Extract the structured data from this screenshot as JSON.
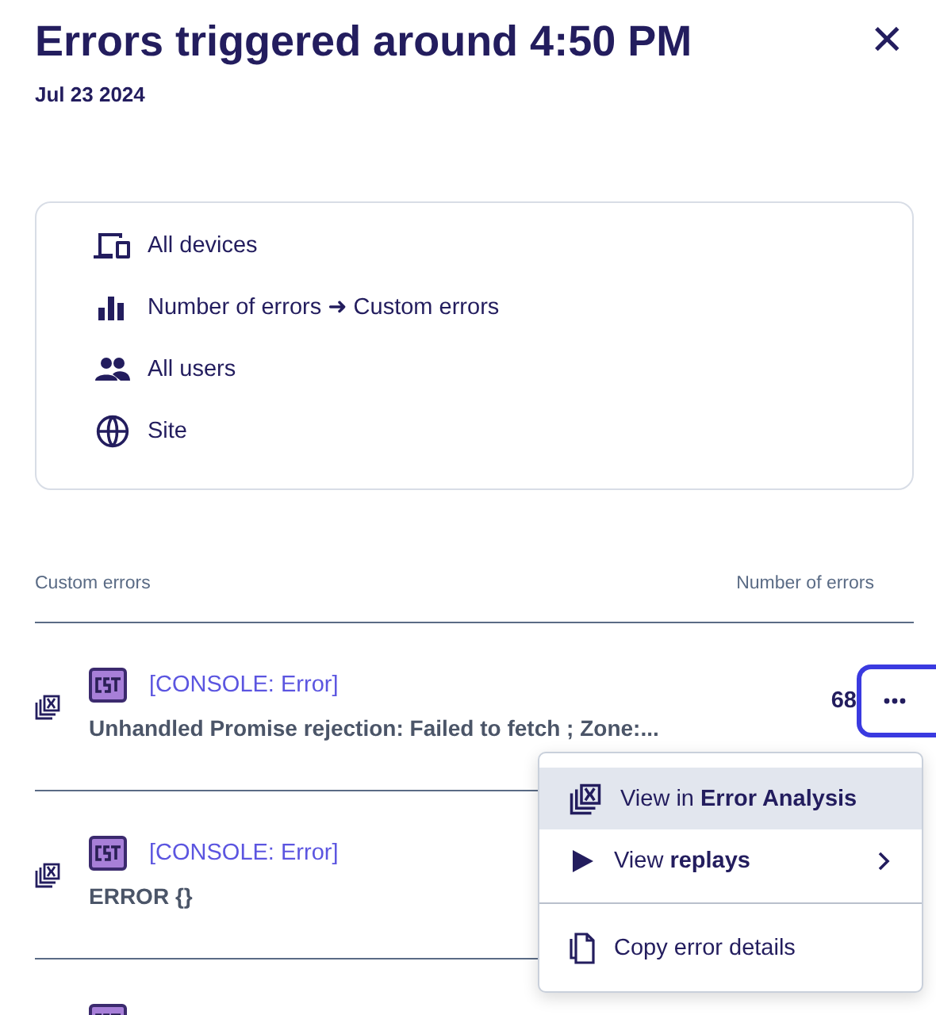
{
  "header": {
    "title": "Errors triggered around 4:50 PM",
    "date": "Jul 23 2024",
    "close_label": "✕"
  },
  "filters": [
    {
      "kind": "devices",
      "label": "All devices"
    },
    {
      "kind": "metric",
      "label": "Number of errors ➜ Custom errors"
    },
    {
      "kind": "users",
      "label": "All users"
    },
    {
      "kind": "site",
      "label": "Site"
    }
  ],
  "table": {
    "columns": [
      "Custom errors",
      "Number of errors"
    ],
    "rows": [
      {
        "type": "[CONSOLE: Error]",
        "message": "Unhandled Promise rejection: Failed to fetch ; Zone:...",
        "count": "68",
        "menu_open": true
      },
      {
        "type": "[CONSOLE: Error]",
        "message": "ERROR {}",
        "count": "",
        "menu_open": false
      },
      {
        "menu_open": false
      }
    ]
  },
  "menu": {
    "items": [
      {
        "kind": "analysis",
        "label": "View in **Error Analysis**",
        "highlighted": true,
        "has_submenu": false
      },
      {
        "kind": "replays",
        "label": "View **replays**",
        "highlighted": false,
        "has_submenu": true
      },
      {
        "kind": "copy",
        "label": "Copy error details",
        "highlighted": false,
        "has_submenu": false
      }
    ]
  }
}
